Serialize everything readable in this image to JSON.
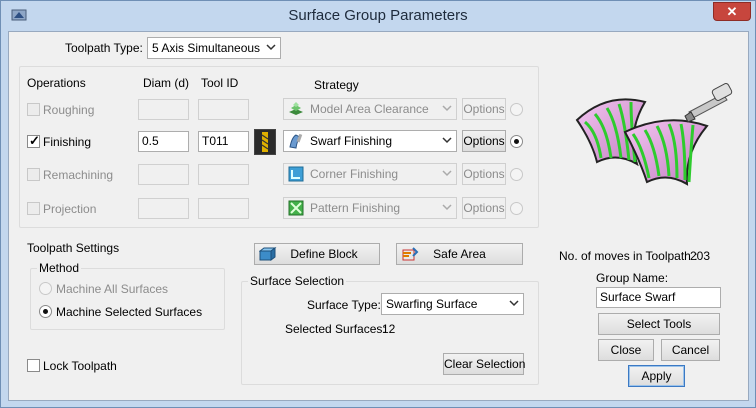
{
  "window": {
    "title": "Surface Group Parameters",
    "close_glyph": "✕"
  },
  "toolpath_type": {
    "label": "Toolpath Type:",
    "value": "5 Axis Simultaneous"
  },
  "operations": {
    "headers": {
      "operations": "Operations",
      "diam": "Diam (d)",
      "tool_id": "Tool ID",
      "strategy": "Strategy"
    },
    "rows": [
      {
        "name": "Roughing",
        "checked": false,
        "enabled": false,
        "diam": "",
        "tool_id": "",
        "strategy": "Model Area Clearance",
        "strategy_icon": "model-area-clearance-icon",
        "options": "Options",
        "selected": false
      },
      {
        "name": "Finishing",
        "checked": true,
        "enabled": true,
        "diam": "0.5",
        "tool_id": "T011",
        "strategy": "Swarf Finishing",
        "strategy_icon": "swarf-finishing-icon",
        "options": "Options",
        "selected": true
      },
      {
        "name": "Remachining",
        "checked": false,
        "enabled": false,
        "diam": "",
        "tool_id": "",
        "strategy": "Corner Finishing",
        "strategy_icon": "corner-finishing-icon",
        "options": "Options",
        "selected": false
      },
      {
        "name": "Projection",
        "checked": false,
        "enabled": false,
        "diam": "",
        "tool_id": "",
        "strategy": "Pattern Finishing",
        "strategy_icon": "pattern-finishing-icon",
        "options": "Options",
        "selected": false
      }
    ]
  },
  "toolpath_settings": {
    "title": "Toolpath Settings",
    "method_title": "Method",
    "options": [
      {
        "label": "Machine All Surfaces",
        "selected": false,
        "enabled": false
      },
      {
        "label": "Machine Selected Surfaces",
        "selected": true,
        "enabled": true
      }
    ],
    "lock_label": "Lock Toolpath"
  },
  "buttons": {
    "define_block": "Define Block",
    "safe_area": "Safe Area",
    "clear_selection": "Clear Selection",
    "select_tools": "Select Tools",
    "close": "Close",
    "cancel": "Cancel",
    "apply": "Apply"
  },
  "surface_selection": {
    "title": "Surface Selection",
    "type_label": "Surface Type:",
    "type_value": "Swarfing Surface",
    "selected_label": "Selected Surfaces:",
    "selected_count": "12"
  },
  "moves": {
    "label": "No. of moves in Toolpath :",
    "count": "203"
  },
  "group_name": {
    "label": "Group Name:",
    "value": "Surface Swarf"
  },
  "colors": {
    "surface_pink": "#e8a6e6",
    "toolpath_green": "#2ecc2e",
    "selection_blue": "#3b79c4"
  }
}
